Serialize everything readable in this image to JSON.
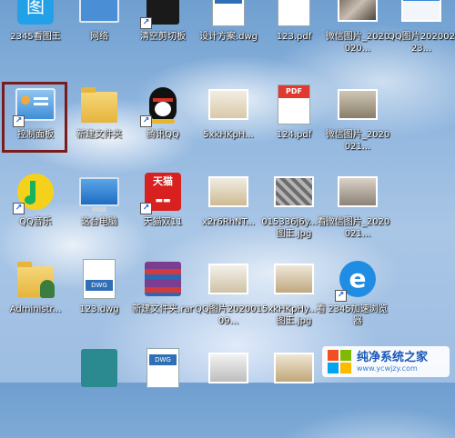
{
  "desktop": {
    "row1": [
      {
        "label": "2345看图王",
        "icon": "image-viewer-icon"
      },
      {
        "label": "网络",
        "icon": "network-icon"
      },
      {
        "label": "清空剪切板",
        "icon": "clipboard-icon"
      },
      {
        "label": "设计方案.dwg",
        "icon": "dwg-file-icon"
      },
      {
        "label": "123.pdf",
        "icon": "pdf-file-icon"
      },
      {
        "label": "微信图片_2020020...",
        "icon": "image-file-icon"
      },
      {
        "label": "QQ图片20200223...",
        "icon": "image-file-icon"
      }
    ],
    "row2": [
      {
        "label": "控制面板",
        "icon": "control-panel-icon"
      },
      {
        "label": "新建文件夹",
        "icon": "folder-icon"
      },
      {
        "label": "腾讯QQ",
        "icon": "qq-penguin-icon"
      },
      {
        "label": "5xkHKpH...",
        "icon": "image-file-icon"
      },
      {
        "label": "124.pdf",
        "icon": "pdf-file-icon"
      },
      {
        "label": "微信图片_2020021...",
        "icon": "image-file-icon"
      }
    ],
    "row3": [
      {
        "label": "QQ音乐",
        "icon": "qq-music-icon"
      },
      {
        "label": "这台电脑",
        "icon": "computer-icon"
      },
      {
        "label": "天猫双11",
        "icon": "tmall-icon"
      },
      {
        "label": "x2r6RhNT...",
        "icon": "image-file-icon"
      },
      {
        "label": "015336j6y...看图王.jpg",
        "icon": "image-file-icon"
      },
      {
        "label": "微信图片_2020021...",
        "icon": "image-file-icon"
      }
    ],
    "row4": [
      {
        "label": "Administr...",
        "icon": "user-folder-icon"
      },
      {
        "label": "123.dwg",
        "icon": "dwg-file-icon"
      },
      {
        "label": "新建文件夹.rar",
        "icon": "rar-archive-icon"
      },
      {
        "label": "QQ图片20200109...",
        "icon": "image-file-icon"
      },
      {
        "label": "5xkHKpHy...看图王.jpg",
        "icon": "image-file-icon"
      },
      {
        "label": "2345加速浏览器",
        "icon": "browser-icon"
      }
    ]
  },
  "selected_item": "控制面板",
  "watermark": {
    "title": "纯净系统之家",
    "url": "www.ycwjzy.com"
  },
  "colors": {
    "selection_frame": "#7a1c1c",
    "label_text": "#ffffff"
  }
}
